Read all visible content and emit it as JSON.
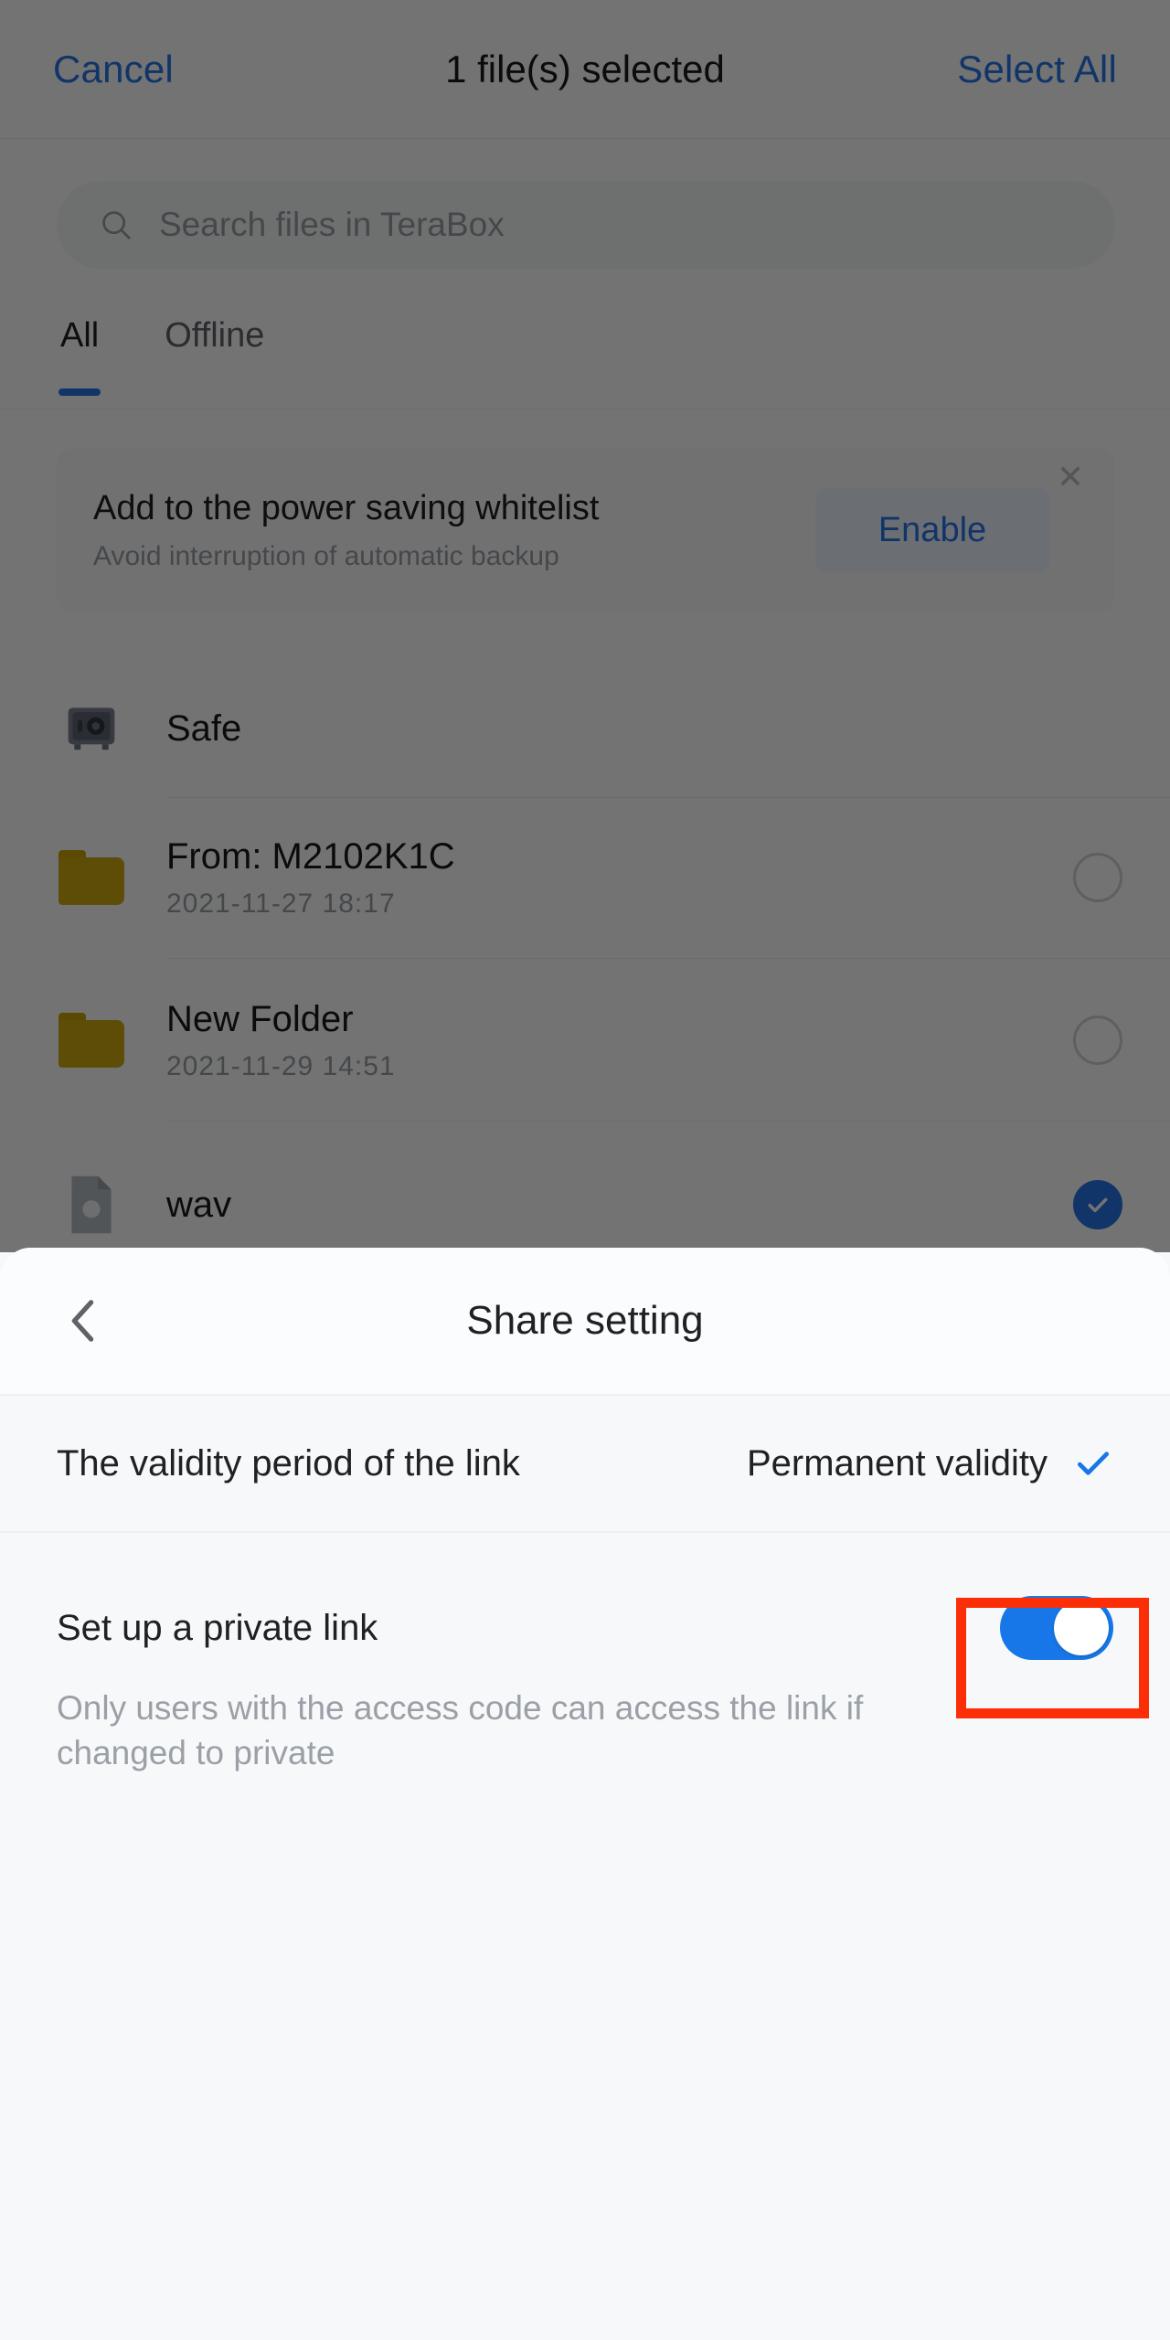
{
  "picker": {
    "header": {
      "cancel_label": "Cancel",
      "title": "1 file(s) selected",
      "select_all_label": "Select All"
    },
    "search": {
      "icon": "search-icon",
      "placeholder": "Search files in TeraBox"
    },
    "tabs": [
      {
        "label": "All",
        "active": true
      },
      {
        "label": "Offline",
        "active": false
      }
    ],
    "banner": {
      "title": "Add to the power saving whitelist",
      "subtitle": "Avoid interruption of automatic backup",
      "button_label": "Enable",
      "close_icon": "close-icon"
    },
    "files": [
      {
        "name": "Safe",
        "date": "",
        "icon": "safe-icon",
        "selected": null
      },
      {
        "name": "From: M2102K1C",
        "date": "2021-11-27  18:17",
        "icon": "folder-icon",
        "selected": false
      },
      {
        "name": "New Folder",
        "date": "2021-11-29  14:51",
        "icon": "folder-icon",
        "selected": false
      },
      {
        "name": "wav",
        "date": "",
        "icon": "file-icon",
        "selected": true
      }
    ]
  },
  "sheet": {
    "back_icon": "chevron-left-icon",
    "title": "Share setting",
    "validity": {
      "label": "The validity period of the link",
      "value": "Permanent validity",
      "check_icon": "check-icon"
    },
    "private_link": {
      "title": "Set up a private link",
      "description": "Only users with the access code can access the link if changed to private",
      "toggle_state": "on"
    }
  },
  "colors": {
    "accent_blue": "#2775e8",
    "toggle_on": "#1877e8",
    "highlight_red": "#fb2e08",
    "folder_yellow": "#cfaa10",
    "sheet_bg": "#f7f8fa",
    "muted_text": "#9aa0a6"
  }
}
